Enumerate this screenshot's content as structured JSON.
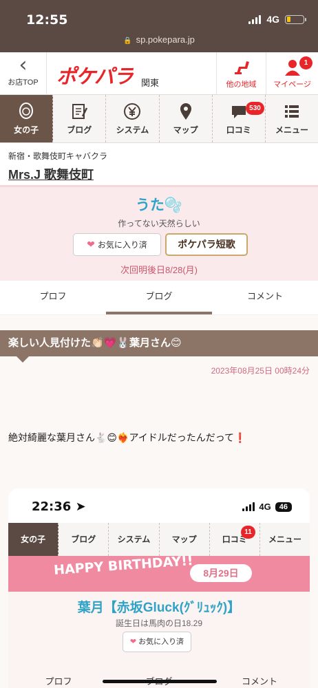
{
  "status_bar": {
    "time": "12:55",
    "network": "4G"
  },
  "url_bar": {
    "url": "sp.pokepara.jp"
  },
  "header": {
    "back_label": "お店TOP",
    "logo": "ポケパラ",
    "region": "関東",
    "other_region_label": "他の地域",
    "mypage_label": "マイページ",
    "mypage_badge": "1"
  },
  "nav": {
    "items": [
      {
        "label": "女の子",
        "icon": "girl-icon"
      },
      {
        "label": "ブログ",
        "icon": "blog-icon"
      },
      {
        "label": "システム",
        "icon": "yen-icon"
      },
      {
        "label": "マップ",
        "icon": "map-pin-icon"
      },
      {
        "label": "口コミ",
        "icon": "speech-bubble-icon",
        "badge": "530"
      },
      {
        "label": "メニュー",
        "icon": "menu-icon"
      }
    ]
  },
  "shop": {
    "category": "新宿・歌舞伎町キャバクラ",
    "name": "Mrs.J 歌舞伎町"
  },
  "girl": {
    "name": "うた🫧",
    "subtitle": "作ってない天然らしい",
    "favorite_label": "お気に入り済",
    "tanka_label": "ポケパラ短歌",
    "next_shift": "次回明後日8/28(月)"
  },
  "tabs": [
    {
      "label": "プロフ"
    },
    {
      "label": "ブログ"
    },
    {
      "label": "コメント"
    }
  ],
  "blog": {
    "title": "楽しい人見付けた👏🏻💗🐰葉月さん😊",
    "date": "2023年08月25日 00時24分",
    "body": "絶対綺麗な葉月さん🐇😊❤️‍🔥アイドルだったんだって❗️"
  },
  "embedded_screenshot": {
    "time": "22:36",
    "network": "4G",
    "battery": "46",
    "nav": [
      "女の子",
      "ブログ",
      "システム",
      "マップ",
      "口コミ",
      "メニュー"
    ],
    "review_badge": "11",
    "banner_text": "HAPPY BIRTHDAY!!",
    "banner_date": "8月29日",
    "girl_name": "葉月【赤坂Gluck(ｸﾞﾘｭｯｸ)】",
    "girl_sub": "誕生日は馬肉の日18.29",
    "favorite_label": "お気に入り済",
    "tabs": [
      "プロフ",
      "ブログ",
      "コメント"
    ]
  },
  "colors": {
    "header_brown": "#5b4a43",
    "brand_red": "#e8262a",
    "pink_bg": "#fbeaec",
    "name_blue": "#2fa3c7",
    "blog_title_bg": "#8c7467"
  }
}
